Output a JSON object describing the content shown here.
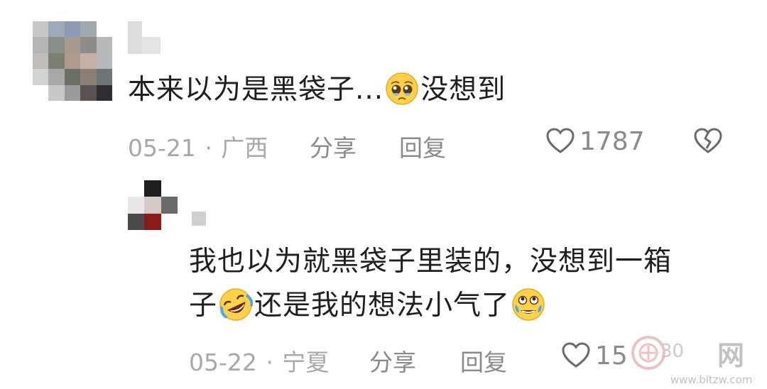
{
  "comments": [
    {
      "text_before": "本来以为是黑袋子...",
      "emoji_1": "pleading-face",
      "text_after": "没想到",
      "date": "05-21",
      "separator": "·",
      "location": "广西",
      "share_label": "分享",
      "reply_label": "回复",
      "like_count": "1787"
    }
  ],
  "replies": [
    {
      "line1": "我也以为就黑袋子里装的，没想到一箱",
      "line2_start": "子",
      "emoji_1": "rolling-on-floor-laughing",
      "line2_mid": "还是我的想法小气了",
      "emoji_2": "face-holding-back-tears",
      "date": "05-22",
      "separator": "·",
      "location": "宁夏",
      "share_label": "分享",
      "reply_label": "回复",
      "like_count": "15"
    }
  ],
  "watermark": {
    "site": "www.bltzw.com",
    "brand": "网",
    "small": "30"
  }
}
